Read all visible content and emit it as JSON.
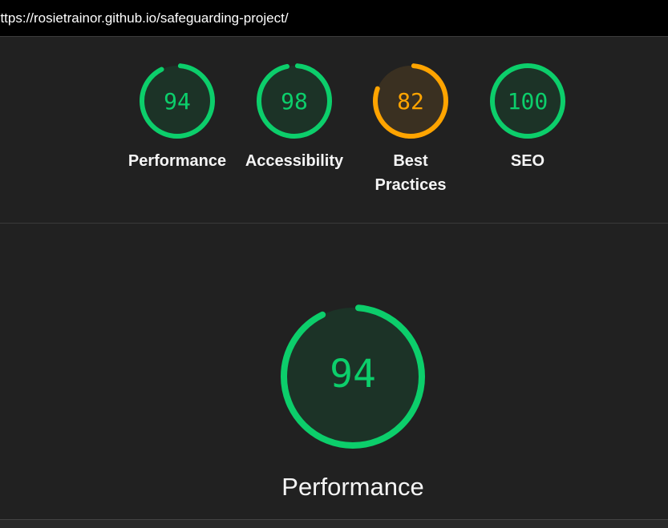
{
  "browser": {
    "url": "https://rosietrainor.github.io/safeguarding-project/"
  },
  "summary_gauges": [
    {
      "score": "94",
      "label": "Performance",
      "color": "#0cce6b",
      "fill": "#1c3327",
      "fraction": 0.94
    },
    {
      "score": "98",
      "label": "Accessibility",
      "color": "#0cce6b",
      "fill": "#1c3327",
      "fraction": 0.98
    },
    {
      "score": "82",
      "label_line1": "Best",
      "label_line2": "Practices",
      "color": "#ffa400",
      "fill": "#3a3021",
      "fraction": 0.82
    },
    {
      "score": "100",
      "label": "SEO",
      "color": "#0cce6b",
      "fill": "#1c3327",
      "fraction": 1.0
    }
  ],
  "category": {
    "score": "94",
    "title": "Performance",
    "color": "#0cce6b",
    "fill": "#1c3327",
    "fraction": 0.94
  }
}
